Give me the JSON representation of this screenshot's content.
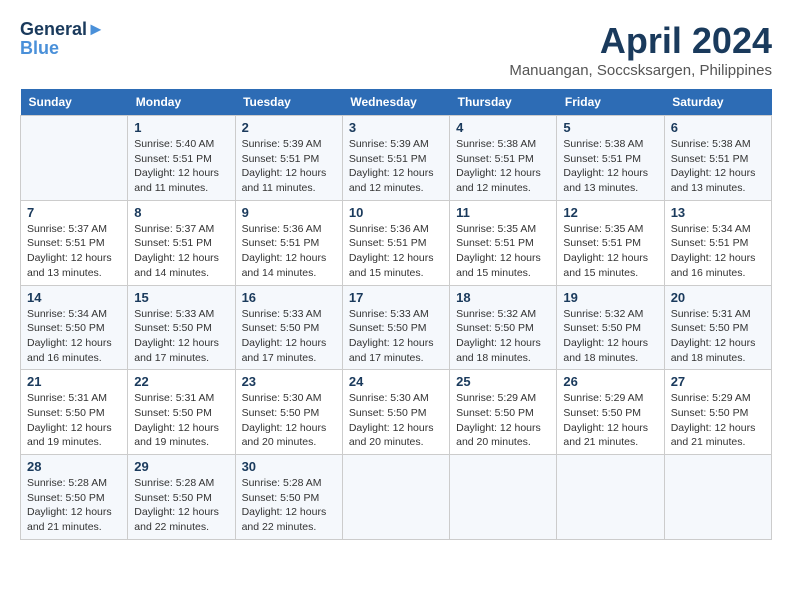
{
  "header": {
    "logo_line1": "General",
    "logo_line2": "Blue",
    "title": "April 2024",
    "subtitle": "Manuangan, Soccsksargen, Philippines"
  },
  "days_of_week": [
    "Sunday",
    "Monday",
    "Tuesday",
    "Wednesday",
    "Thursday",
    "Friday",
    "Saturday"
  ],
  "weeks": [
    [
      {
        "day": "",
        "info": ""
      },
      {
        "day": "1",
        "info": "Sunrise: 5:40 AM\nSunset: 5:51 PM\nDaylight: 12 hours\nand 11 minutes."
      },
      {
        "day": "2",
        "info": "Sunrise: 5:39 AM\nSunset: 5:51 PM\nDaylight: 12 hours\nand 11 minutes."
      },
      {
        "day": "3",
        "info": "Sunrise: 5:39 AM\nSunset: 5:51 PM\nDaylight: 12 hours\nand 12 minutes."
      },
      {
        "day": "4",
        "info": "Sunrise: 5:38 AM\nSunset: 5:51 PM\nDaylight: 12 hours\nand 12 minutes."
      },
      {
        "day": "5",
        "info": "Sunrise: 5:38 AM\nSunset: 5:51 PM\nDaylight: 12 hours\nand 13 minutes."
      },
      {
        "day": "6",
        "info": "Sunrise: 5:38 AM\nSunset: 5:51 PM\nDaylight: 12 hours\nand 13 minutes."
      }
    ],
    [
      {
        "day": "7",
        "info": "Sunrise: 5:37 AM\nSunset: 5:51 PM\nDaylight: 12 hours\nand 13 minutes."
      },
      {
        "day": "8",
        "info": "Sunrise: 5:37 AM\nSunset: 5:51 PM\nDaylight: 12 hours\nand 14 minutes."
      },
      {
        "day": "9",
        "info": "Sunrise: 5:36 AM\nSunset: 5:51 PM\nDaylight: 12 hours\nand 14 minutes."
      },
      {
        "day": "10",
        "info": "Sunrise: 5:36 AM\nSunset: 5:51 PM\nDaylight: 12 hours\nand 15 minutes."
      },
      {
        "day": "11",
        "info": "Sunrise: 5:35 AM\nSunset: 5:51 PM\nDaylight: 12 hours\nand 15 minutes."
      },
      {
        "day": "12",
        "info": "Sunrise: 5:35 AM\nSunset: 5:51 PM\nDaylight: 12 hours\nand 15 minutes."
      },
      {
        "day": "13",
        "info": "Sunrise: 5:34 AM\nSunset: 5:51 PM\nDaylight: 12 hours\nand 16 minutes."
      }
    ],
    [
      {
        "day": "14",
        "info": "Sunrise: 5:34 AM\nSunset: 5:50 PM\nDaylight: 12 hours\nand 16 minutes."
      },
      {
        "day": "15",
        "info": "Sunrise: 5:33 AM\nSunset: 5:50 PM\nDaylight: 12 hours\nand 17 minutes."
      },
      {
        "day": "16",
        "info": "Sunrise: 5:33 AM\nSunset: 5:50 PM\nDaylight: 12 hours\nand 17 minutes."
      },
      {
        "day": "17",
        "info": "Sunrise: 5:33 AM\nSunset: 5:50 PM\nDaylight: 12 hours\nand 17 minutes."
      },
      {
        "day": "18",
        "info": "Sunrise: 5:32 AM\nSunset: 5:50 PM\nDaylight: 12 hours\nand 18 minutes."
      },
      {
        "day": "19",
        "info": "Sunrise: 5:32 AM\nSunset: 5:50 PM\nDaylight: 12 hours\nand 18 minutes."
      },
      {
        "day": "20",
        "info": "Sunrise: 5:31 AM\nSunset: 5:50 PM\nDaylight: 12 hours\nand 18 minutes."
      }
    ],
    [
      {
        "day": "21",
        "info": "Sunrise: 5:31 AM\nSunset: 5:50 PM\nDaylight: 12 hours\nand 19 minutes."
      },
      {
        "day": "22",
        "info": "Sunrise: 5:31 AM\nSunset: 5:50 PM\nDaylight: 12 hours\nand 19 minutes."
      },
      {
        "day": "23",
        "info": "Sunrise: 5:30 AM\nSunset: 5:50 PM\nDaylight: 12 hours\nand 20 minutes."
      },
      {
        "day": "24",
        "info": "Sunrise: 5:30 AM\nSunset: 5:50 PM\nDaylight: 12 hours\nand 20 minutes."
      },
      {
        "day": "25",
        "info": "Sunrise: 5:29 AM\nSunset: 5:50 PM\nDaylight: 12 hours\nand 20 minutes."
      },
      {
        "day": "26",
        "info": "Sunrise: 5:29 AM\nSunset: 5:50 PM\nDaylight: 12 hours\nand 21 minutes."
      },
      {
        "day": "27",
        "info": "Sunrise: 5:29 AM\nSunset: 5:50 PM\nDaylight: 12 hours\nand 21 minutes."
      }
    ],
    [
      {
        "day": "28",
        "info": "Sunrise: 5:28 AM\nSunset: 5:50 PM\nDaylight: 12 hours\nand 21 minutes."
      },
      {
        "day": "29",
        "info": "Sunrise: 5:28 AM\nSunset: 5:50 PM\nDaylight: 12 hours\nand 22 minutes."
      },
      {
        "day": "30",
        "info": "Sunrise: 5:28 AM\nSunset: 5:50 PM\nDaylight: 12 hours\nand 22 minutes."
      },
      {
        "day": "",
        "info": ""
      },
      {
        "day": "",
        "info": ""
      },
      {
        "day": "",
        "info": ""
      },
      {
        "day": "",
        "info": ""
      }
    ]
  ]
}
